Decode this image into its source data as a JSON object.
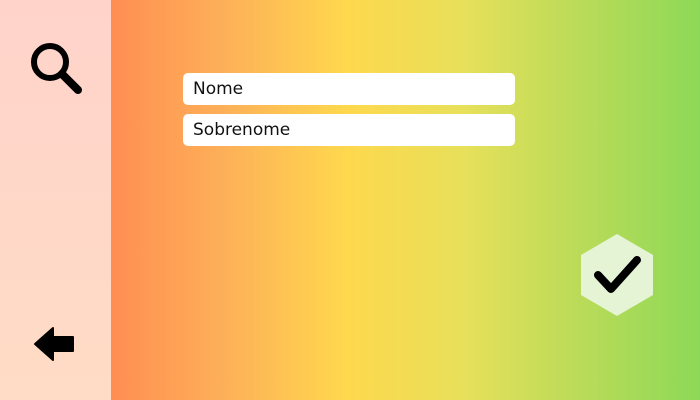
{
  "sidebar": {
    "search_icon": "search-icon",
    "back_icon": "arrow-left-icon"
  },
  "form": {
    "first_name": {
      "placeholder": "Nome",
      "value": ""
    },
    "last_name": {
      "placeholder": "Sobrenome",
      "value": ""
    }
  },
  "confirm": {
    "icon": "check-icon",
    "color": "#e6f4d6"
  },
  "colors": {
    "sidebar": "#ffd5c8",
    "gradient_left": "#ff8e52",
    "gradient_mid": "#fed84d",
    "gradient_right": "#8dd957"
  }
}
